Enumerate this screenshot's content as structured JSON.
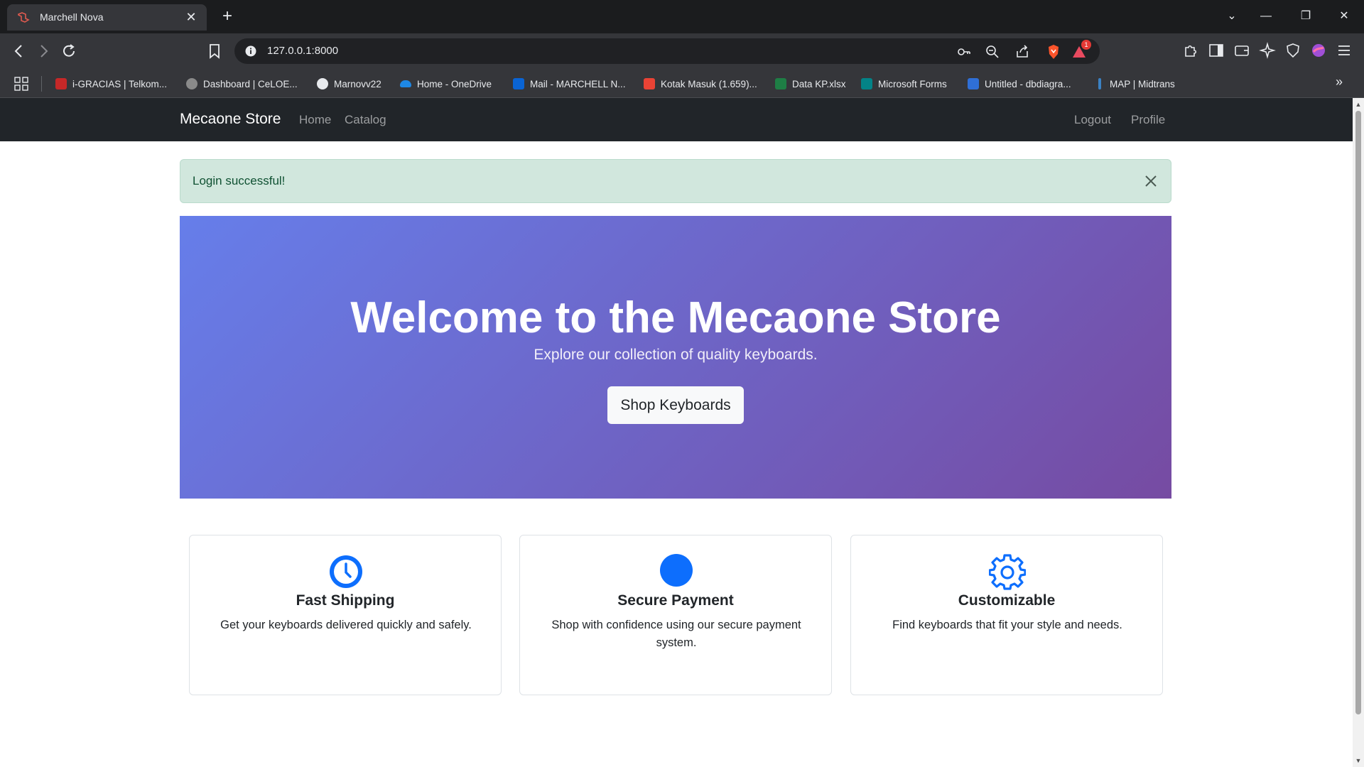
{
  "browser": {
    "tab_title": "Marchell Nova",
    "url": "127.0.0.1:8000",
    "notification_count": "1",
    "bookmarks": [
      {
        "label": "i-GRACIAS | Telkom...",
        "icon": "igracias-icon",
        "color": "#c62828"
      },
      {
        "label": "Dashboard | CeLOE...",
        "icon": "celoe-icon",
        "color": "#8a8a8a"
      },
      {
        "label": "Marnovv22",
        "icon": "github-icon",
        "color": "#e8eaed"
      },
      {
        "label": "Home - OneDrive",
        "icon": "onedrive-icon",
        "color": "#1e88e5"
      },
      {
        "label": "Mail - MARCHELL N...",
        "icon": "outlook-icon",
        "color": "#0a64d4"
      },
      {
        "label": "Kotak Masuk (1.659)...",
        "icon": "gmail-icon",
        "color": "#ea4335"
      },
      {
        "label": "Data KP.xlsx",
        "icon": "excel-icon",
        "color": "#1e7e45"
      },
      {
        "label": "Microsoft Forms",
        "icon": "forms-icon",
        "color": "#038387"
      },
      {
        "label": "Untitled - dbdiagra...",
        "icon": "dbdiagram-icon",
        "color": "#2f6fd6"
      },
      {
        "label": "MAP | Midtrans",
        "icon": "midtrans-icon",
        "color": "#3b82c4"
      }
    ]
  },
  "site": {
    "brand": "Mecaone Store",
    "nav_left": [
      "Home",
      "Catalog"
    ],
    "nav_right": [
      "Logout",
      "Profile"
    ]
  },
  "alert": {
    "message": "Login successful!",
    "background": "#d1e7dd",
    "text_color": "#0f5132"
  },
  "hero": {
    "title": "Welcome to the Mecaone Store",
    "subtitle": "Explore our collection of quality keyboards.",
    "button": "Shop Keyboards",
    "gradient_start": "#667eea",
    "gradient_end": "#764ba2"
  },
  "features": [
    {
      "icon": "clock-icon",
      "title": "Fast Shipping",
      "text": "Get your keyboards delivered quickly and safely."
    },
    {
      "icon": "circle-icon",
      "title": "Secure Payment",
      "text": "Shop with confidence using our secure payment system."
    },
    {
      "icon": "gear-icon",
      "title": "Customizable",
      "text": "Find keyboards that fit your style and needs."
    }
  ],
  "accent_color": "#0d6efd"
}
